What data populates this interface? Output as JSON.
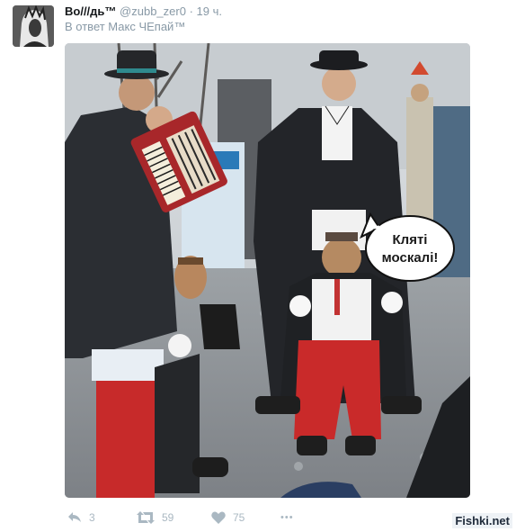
{
  "tweet": {
    "author_name": "Во///дь™",
    "author_handle": "@zubb_zer0",
    "separator": "·",
    "time": "19 ч.",
    "reply_to": "В ответ Макс ЧЕпай™",
    "photo": {
      "speech_bubble": {
        "line1": "Кляті",
        "line2": "москалі!"
      }
    },
    "actions": {
      "reply": {
        "icon": "reply-icon",
        "count": "3"
      },
      "retweet": {
        "icon": "retweet-icon",
        "count": "59"
      },
      "like": {
        "icon": "heart-icon",
        "count": "75"
      },
      "more": {
        "icon": "more-icon",
        "label": "•••"
      }
    }
  },
  "watermark": "Fishki.net",
  "colors": {
    "name": "#14171a",
    "muted": "#8899a6",
    "action": "#aab8c2"
  }
}
